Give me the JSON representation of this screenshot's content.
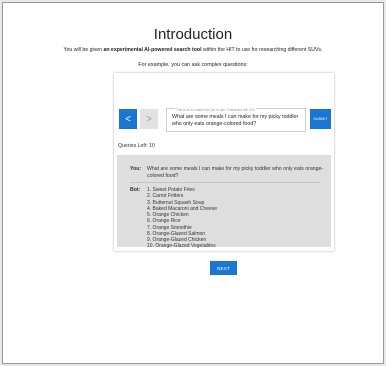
{
  "header": {
    "title": "Introduction",
    "intro_before": "You will be given ",
    "intro_bold": "an experimental AI-powered search tool",
    "intro_after": " within the HIT to use for researching different SUVs.",
    "example_line": "For example, you can ask complex questions:"
  },
  "search": {
    "back_glyph": "<",
    "forward_glyph": ">",
    "hint": "This is an AI chatbot for you to use. Characters left: 914",
    "query": "What are some meals I can make for my picky toddler who only eats orange-colored food?",
    "submit_label": "SUBMIT"
  },
  "queries_left": "Queries Left: 10",
  "chat": {
    "you_label": "You:",
    "you_text": "What are some meals I can make for my picky toddler who only eats orange-colored food?",
    "bot_label": "Bot:",
    "bot_items": [
      "1. Sweet Potato Fries",
      "2. Carrot Fritters",
      "3. Butternut Squash Soup",
      "4. Baked Macaroni and Cheese",
      "5. Orange Chicken",
      "6. Orange Rice",
      "7. Orange Smoothie",
      "8. Orange-Glazed Salmon",
      "9. Orange-Glazed Chicken",
      "10. Orange-Glazed Vegetables"
    ]
  },
  "next_label": "NEXT",
  "colors": {
    "accent": "#1976d2",
    "chat_bg": "#dedede"
  }
}
